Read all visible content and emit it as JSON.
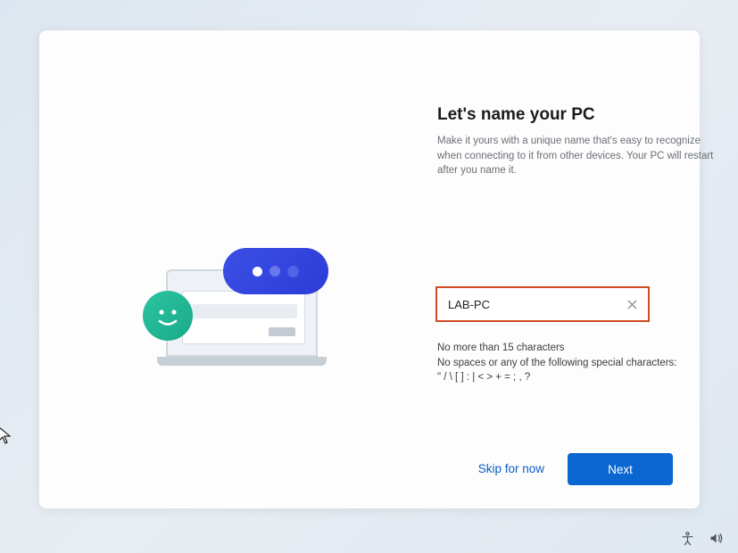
{
  "heading": "Let's name your PC",
  "subtitle": "Make it yours with a unique name that's easy to recognize when connecting to it from other devices. Your PC will restart after you name it.",
  "pc_name_value": "LAB-PC",
  "rules_line1": "No more than 15 characters",
  "rules_line2": "No spaces or any of the following special characters:",
  "rules_line3": "\" / \\ [ ] : | < > + = ; , ?",
  "skip_label": "Skip for now",
  "next_label": "Next",
  "accent_color": "#0a66d0",
  "input_border_color": "#d04a23"
}
